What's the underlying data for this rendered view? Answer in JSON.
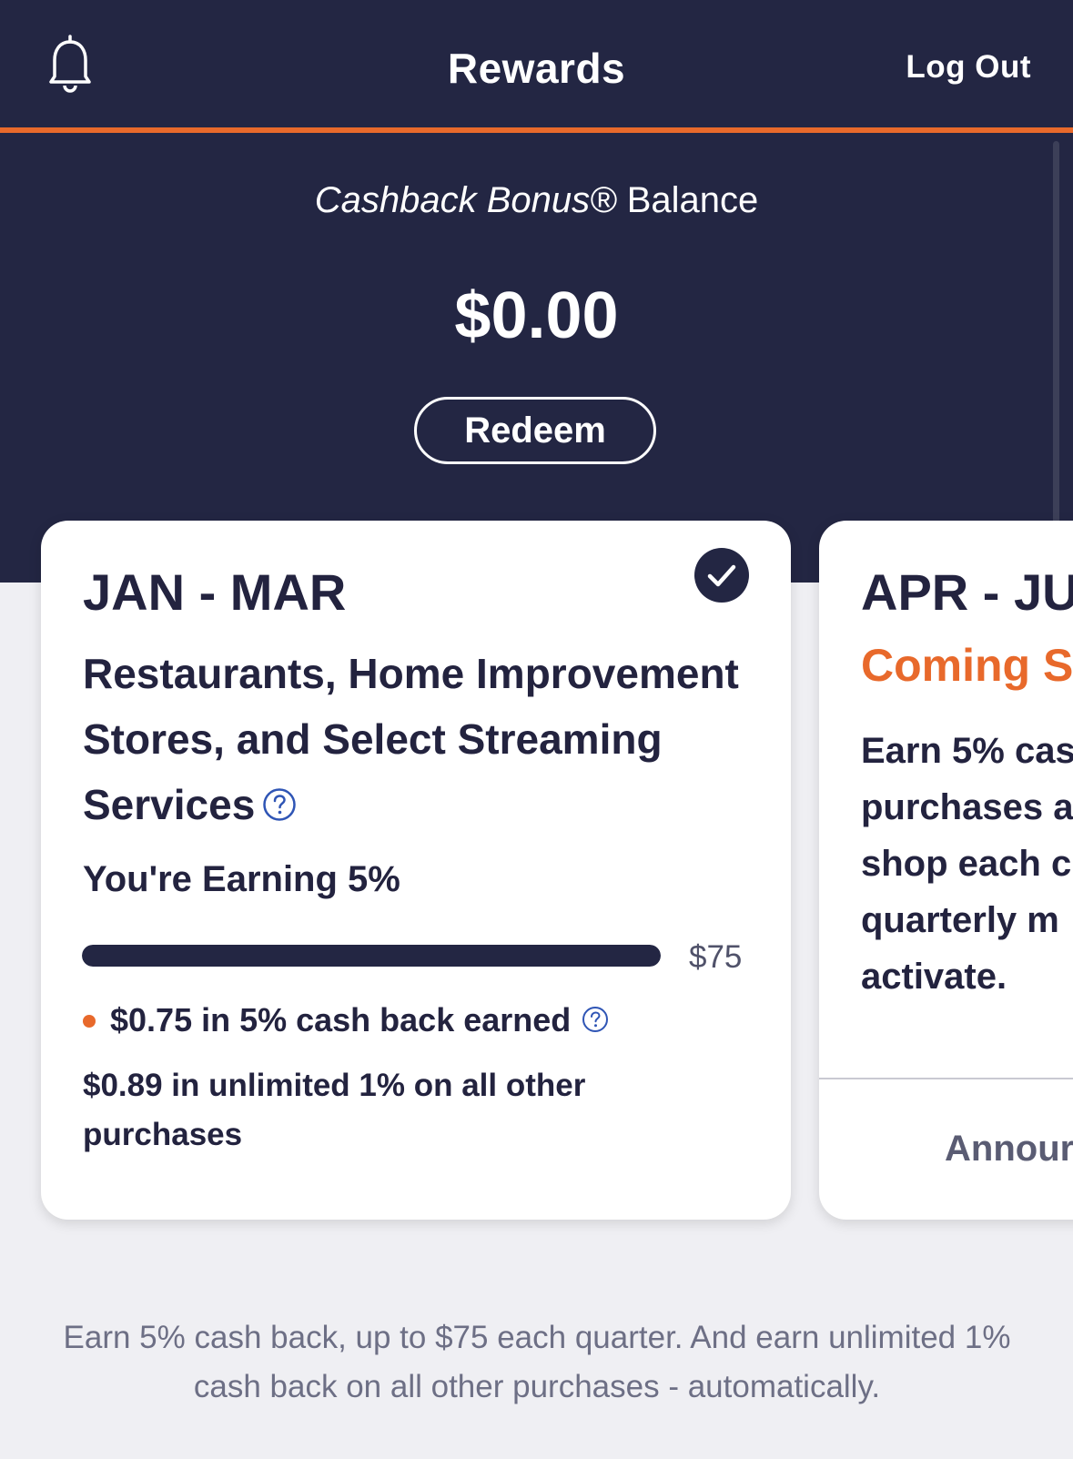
{
  "header": {
    "title": "Rewards",
    "logout_label": "Log Out"
  },
  "balance": {
    "label_italic": "Cashback Bonus®",
    "label_rest": " Balance",
    "amount": "$0.00",
    "redeem_label": "Redeem"
  },
  "cards": [
    {
      "period": "JAN - MAR",
      "category": "Restaurants, Home Improvement Stores, and Select Streaming Services",
      "earning_label": "You're Earning 5%",
      "progress_fraction": 1.0,
      "progress_max_label": "$75",
      "earned_text": "$0.75 in 5% cash back earned",
      "unlimited_text": "$0.89 in unlimited 1% on all other purchases",
      "activated": true
    },
    {
      "period": "APR - JU",
      "status": "Coming S",
      "desc_lines": [
        "Earn 5% cas",
        "purchases a",
        "shop each c",
        "quarterly m",
        "activate."
      ],
      "footer_label": "Annour"
    }
  ],
  "footer": {
    "text": "Earn 5% cash back, up to $75 each quarter. And earn unlimited 1% cash back on all other purchases - automatically."
  },
  "colors": {
    "navy": "#232643",
    "accent": "#e8692b",
    "background": "#efeff3"
  },
  "icons": {
    "bell": "bell-icon",
    "check": "check-circle-icon",
    "help": "question-circle-icon"
  }
}
